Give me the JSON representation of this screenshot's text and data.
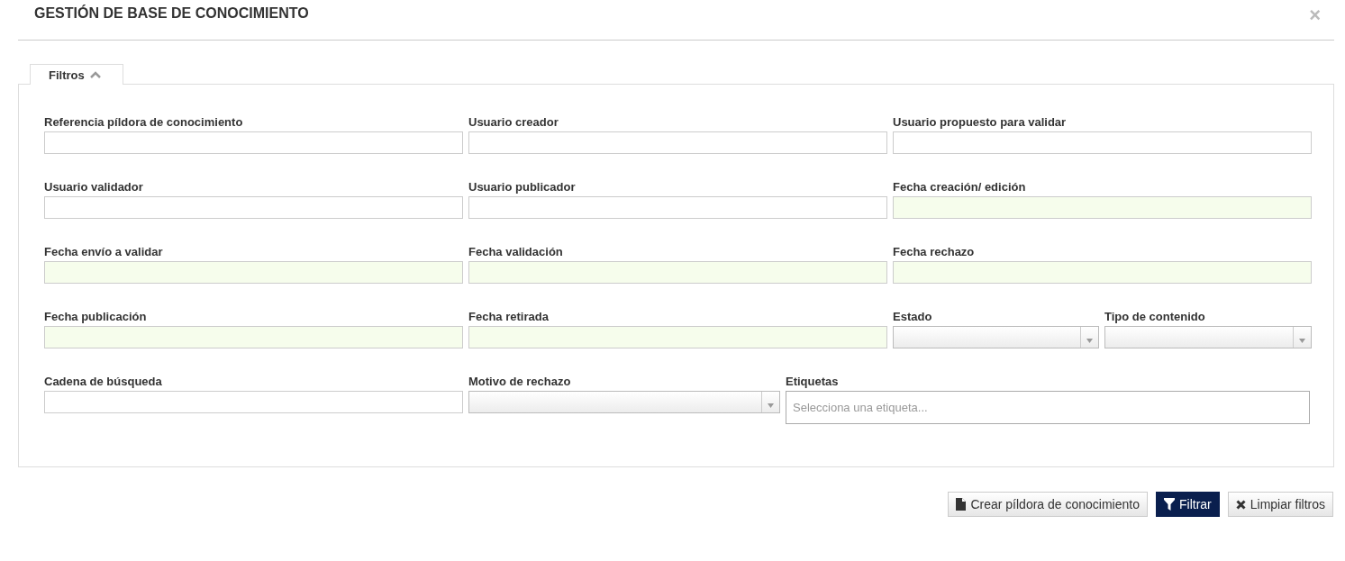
{
  "window": {
    "title": "GESTIÓN DE BASE DE CONOCIMIENTO",
    "close": "×"
  },
  "filters_tab": {
    "label": "Filtros",
    "expanded": true
  },
  "rows": [
    [
      {
        "label": "Referencia píldora de conocimiento",
        "kind": "text"
      },
      {
        "label": "Usuario creador",
        "kind": "text"
      },
      {
        "label": "Usuario propuesto para validar",
        "kind": "text"
      }
    ],
    [
      {
        "label": "Usuario validador",
        "kind": "text"
      },
      {
        "label": "Usuario publicador",
        "kind": "text"
      },
      {
        "label": "Fecha creación/ edición",
        "kind": "date"
      }
    ],
    [
      {
        "label": "Fecha envío a validar",
        "kind": "date"
      },
      {
        "label": "Fecha validación",
        "kind": "date"
      },
      {
        "label": "Fecha rechazo",
        "kind": "date"
      }
    ],
    [
      {
        "label": "Fecha publicación",
        "kind": "date"
      },
      {
        "label": "Fecha retirada",
        "kind": "date"
      },
      {
        "label": "Estado",
        "kind": "select"
      },
      {
        "label": "Tipo de contenido",
        "kind": "select"
      }
    ],
    [
      {
        "label": "Cadena de búsqueda",
        "kind": "text"
      },
      {
        "label": "Motivo de rechazo",
        "kind": "select"
      },
      {
        "label": "Etiquetas",
        "kind": "tags",
        "placeholder": "Selecciona una etiqueta..."
      }
    ]
  ],
  "buttons": [
    {
      "label": "Crear píldora de conocimiento",
      "kind": "file"
    },
    {
      "label": "Filtrar",
      "kind": "filter"
    },
    {
      "label": "Limpiar filtros",
      "kind": "clear"
    }
  ]
}
